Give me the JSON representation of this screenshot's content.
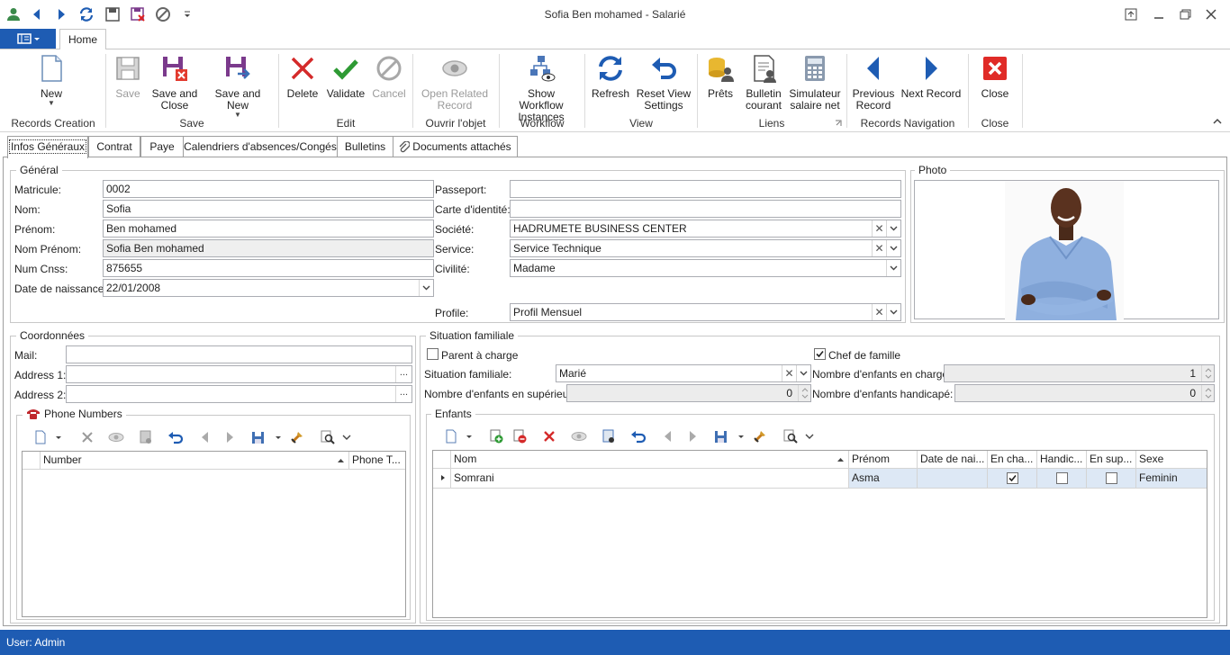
{
  "window": {
    "title": "Sofia Ben mohamed - Salarié"
  },
  "ribbon": {
    "tab_home": "Home",
    "buttons": {
      "new": "New",
      "save": "Save",
      "save_close": "Save and Close",
      "save_new": "Save and New",
      "delete": "Delete",
      "validate": "Validate",
      "cancel": "Cancel",
      "open_related": "Open Related Record",
      "show_workflow": "Show Workflow Instances",
      "refresh": "Refresh",
      "reset_view": "Reset View Settings",
      "prets": "Prêts",
      "bulletin": "Bulletin courant",
      "simulateur": "Simulateur salaire net",
      "previous": "Previous Record",
      "next": "Next Record",
      "close": "Close"
    },
    "groups": {
      "records_creation": "Records Creation",
      "save": "Save",
      "edit": "Edit",
      "ouvrir": "Ouvrir l'objet",
      "workflow": "Workflow",
      "view": "View",
      "liens": "Liens",
      "records_navigation": "Records Navigation",
      "close": "Close"
    }
  },
  "tabs": [
    "Infos Généraux",
    "Contrat",
    "Paye",
    "Calendriers d'absences/Congés",
    "Bulletins",
    "Documents attachés"
  ],
  "general": {
    "title": "Général",
    "matricule": {
      "label": "Matricule:",
      "value": "0002"
    },
    "nom": {
      "label": "Nom:",
      "value": "Sofia"
    },
    "prenom": {
      "label": "Prénom:",
      "value": "Ben mohamed"
    },
    "nom_prenom": {
      "label": "Nom  Prénom:",
      "value": "Sofia Ben mohamed"
    },
    "num_cnss": {
      "label": "Num Cnss:",
      "value": "875655"
    },
    "date_naissance": {
      "label": "Date de naissance:",
      "value": "22/01/2008"
    },
    "passeport": {
      "label": "Passeport:",
      "value": ""
    },
    "carte_identite": {
      "label": "Carte d'identité:",
      "value": ""
    },
    "societe": {
      "label": "Société:",
      "value": "HADRUMETE BUSINESS CENTER"
    },
    "service": {
      "label": "Service:",
      "value": "Service Technique"
    },
    "civilite": {
      "label": "Civilité:",
      "value": "Madame"
    },
    "profile": {
      "label": "Profile:",
      "value": "Profil Mensuel"
    }
  },
  "photo": {
    "title": "Photo"
  },
  "coordonnees": {
    "title": "Coordonnées",
    "mail": {
      "label": "Mail:",
      "value": ""
    },
    "address1": {
      "label": "Address 1:",
      "value": ""
    },
    "address2": {
      "label": "Address 2:",
      "value": ""
    },
    "ellipsis": "...",
    "phone_numbers": {
      "title": "Phone Numbers",
      "columns": [
        "Number",
        "Phone T..."
      ]
    }
  },
  "situation": {
    "title": "Situation familiale",
    "parent_charge": {
      "label": "Parent à charge",
      "checked": false
    },
    "chef_famille": {
      "label": "Chef de famille",
      "checked": true
    },
    "situation_familiale": {
      "label": "Situation familiale:",
      "value": "Marié"
    },
    "nb_enfants_charge": {
      "label": "Nombre d'enfants en charge:",
      "value": "1"
    },
    "nb_enfants_superieur": {
      "label": "Nombre d'enfants en supérieur:",
      "value": "0"
    },
    "nb_enfants_handicape": {
      "label": "Nombre d'enfants handicapé:",
      "value": "0"
    },
    "enfants": {
      "title": "Enfants",
      "columns": [
        "Nom",
        "Prénom",
        "Date de nai...",
        "En cha...",
        "Handic...",
        "En sup...",
        "Sexe"
      ],
      "rows": [
        {
          "nom": "Somrani",
          "prenom": "Asma",
          "date": "",
          "en_charge": true,
          "handicape": false,
          "en_sup": false,
          "sexe": "Feminin"
        }
      ]
    }
  },
  "status": {
    "user": "User: Admin"
  },
  "colors": {
    "accent": "#1e5cb3",
    "selected_row": "#dde8f5"
  }
}
